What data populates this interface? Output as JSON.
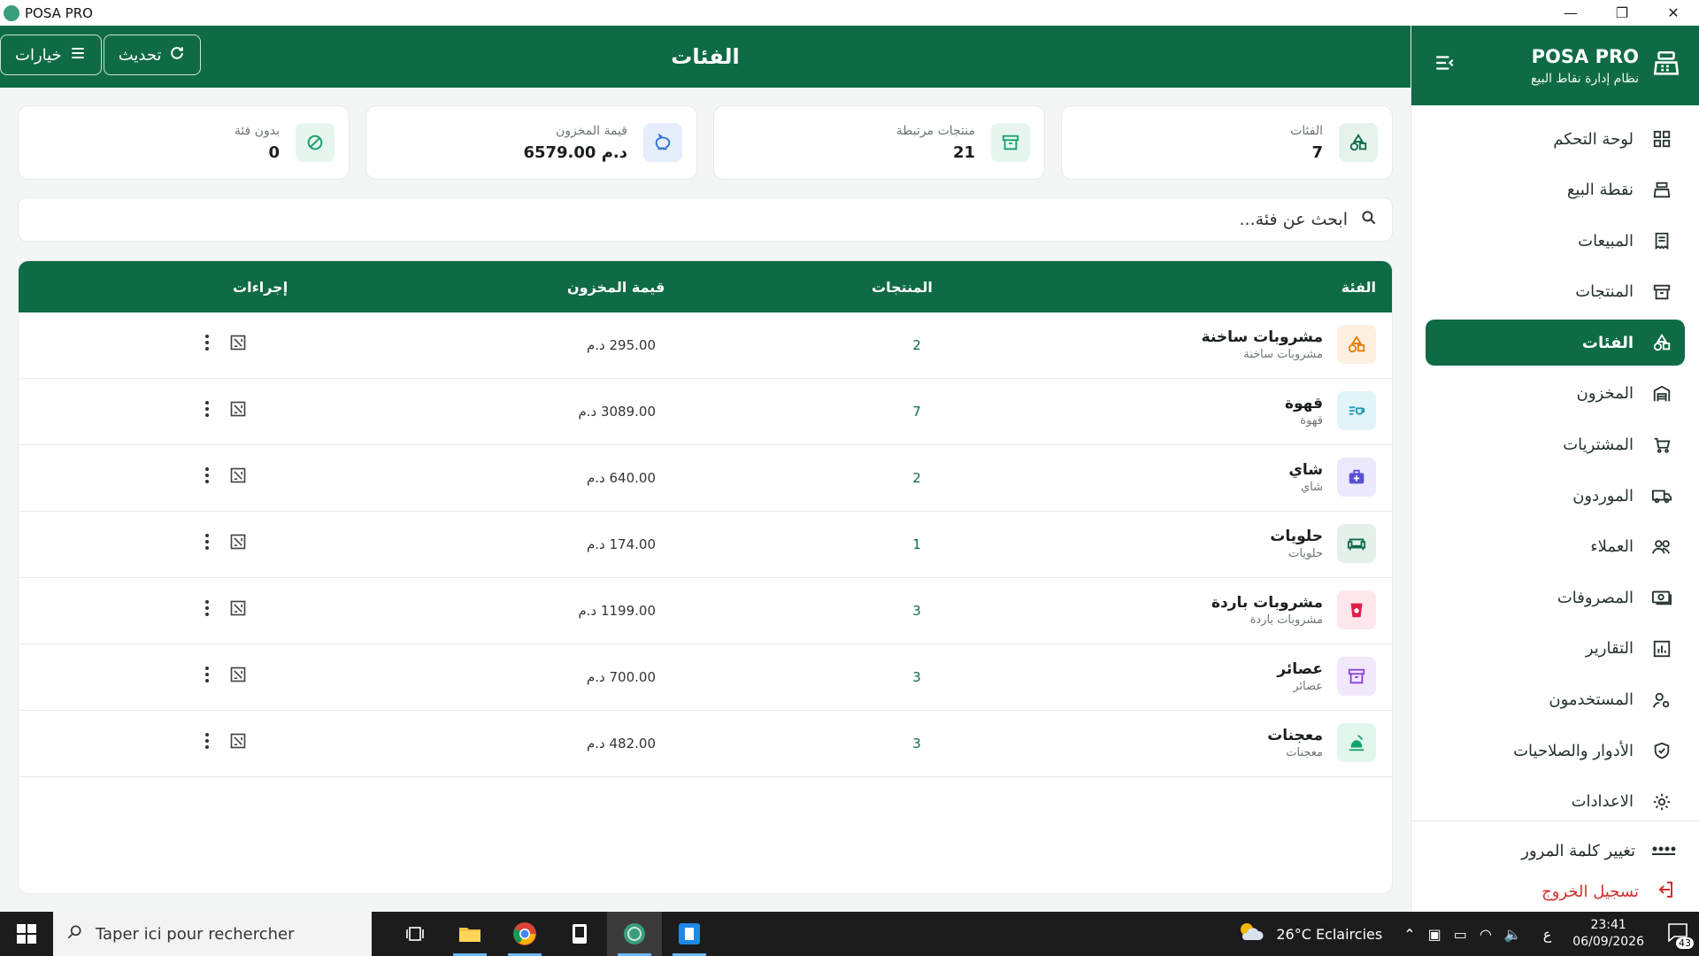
{
  "window": {
    "title": "POSA PRO",
    "controls": [
      "—",
      "❐",
      "✕"
    ]
  },
  "sidebar": {
    "brand": "POSA PRO",
    "tagline": "نظام إدارة نقاط البيع",
    "items": [
      {
        "label": "لوحة التحكم",
        "icon": "dashboard-icon",
        "active": false
      },
      {
        "label": "نقطة البيع",
        "icon": "cash-register-icon",
        "active": false
      },
      {
        "label": "المبيعات",
        "icon": "receipt-icon",
        "active": false
      },
      {
        "label": "المنتجات",
        "icon": "archive-icon",
        "active": false
      },
      {
        "label": "الفئات",
        "icon": "shapes-icon",
        "active": true
      },
      {
        "label": "المخزون",
        "icon": "warehouse-icon",
        "active": false
      },
      {
        "label": "المشتريات",
        "icon": "cart-icon",
        "active": false
      },
      {
        "label": "الموردون",
        "icon": "truck-icon",
        "active": false
      },
      {
        "label": "العملاء",
        "icon": "users-icon",
        "active": false
      },
      {
        "label": "المصروفات",
        "icon": "cash-icon",
        "active": false
      },
      {
        "label": "التقارير",
        "icon": "chart-icon",
        "active": false
      },
      {
        "label": "المستخدمون",
        "icon": "user-cog-icon",
        "active": false
      },
      {
        "label": "الأدوار والصلاحيات",
        "icon": "shield-icon",
        "active": false
      },
      {
        "label": "الاعدادات",
        "icon": "gear-icon",
        "active": false
      }
    ],
    "change_password": "تغيير كلمة المرور",
    "logout": "تسجيل الخروج"
  },
  "header": {
    "title": "الفئات",
    "refresh_label": "تحديث",
    "options_label": "خيارات"
  },
  "stats": [
    {
      "label": "الفئات",
      "value": "7",
      "icon": "shapes-icon",
      "color": "#0f6b45",
      "bg": "#e6f3ed"
    },
    {
      "label": "منتجات مرتبطة",
      "value": "21",
      "icon": "archive-icon",
      "color": "#1aa06b",
      "bg": "#e6f6ef"
    },
    {
      "label": "قيمة المخزون",
      "value": "6579.00 د.م",
      "icon": "piggy-bank-icon",
      "color": "#2f6fd6",
      "bg": "#e6eefb"
    },
    {
      "label": "بدون فئة",
      "value": "0",
      "icon": "block-icon",
      "color": "#1aa06b",
      "bg": "#e6f6ef"
    }
  ],
  "search": {
    "placeholder": "ابحث عن فئة..."
  },
  "table": {
    "headers": {
      "category": "الفئة",
      "products": "المنتجات",
      "stock_value": "قيمة المخزون",
      "actions": "إجراءات"
    },
    "rows": [
      {
        "name": "مشروبات ساخنة",
        "sub": "مشروبات ساخنة",
        "products": "2",
        "value": "295.00 د.م",
        "icon": "shapes-icon",
        "color": "#e67e10",
        "bg": "#fdf0e1"
      },
      {
        "name": "قهوة",
        "sub": "قهوة",
        "products": "7",
        "value": "3089.00 د.م",
        "icon": "coffee-icon",
        "color": "#1b9bb5",
        "bg": "#e2f4f8"
      },
      {
        "name": "شاي",
        "sub": "شاي",
        "products": "2",
        "value": "640.00 د.م",
        "icon": "medkit-icon",
        "color": "#5b4fd8",
        "bg": "#ebe9fb"
      },
      {
        "name": "حلويات",
        "sub": "حلويات",
        "products": "1",
        "value": "174.00 د.م",
        "icon": "sofa-icon",
        "color": "#0f6b45",
        "bg": "#e3f1ea"
      },
      {
        "name": "مشروبات باردة",
        "sub": "مشروبات باردة",
        "products": "3",
        "value": "1199.00 د.م",
        "icon": "cup-icon",
        "color": "#e11d48",
        "bg": "#fde6ec"
      },
      {
        "name": "عصائر",
        "sub": "عصائر",
        "products": "3",
        "value": "700.00 د.م",
        "icon": "archive-icon",
        "color": "#8b3fe0",
        "bg": "#f1e8fc"
      },
      {
        "name": "معجنات",
        "sub": "معجنات",
        "products": "3",
        "value": "482.00 د.م",
        "icon": "food-icon",
        "color": "#12a36a",
        "bg": "#e3f6ee"
      }
    ]
  },
  "taskbar": {
    "search_placeholder": "Taper ici pour rechercher",
    "weather": "26°C  Eclaircies",
    "lang": "ع",
    "time": "23:41",
    "date": "06/09/2026",
    "notifications": "43"
  }
}
